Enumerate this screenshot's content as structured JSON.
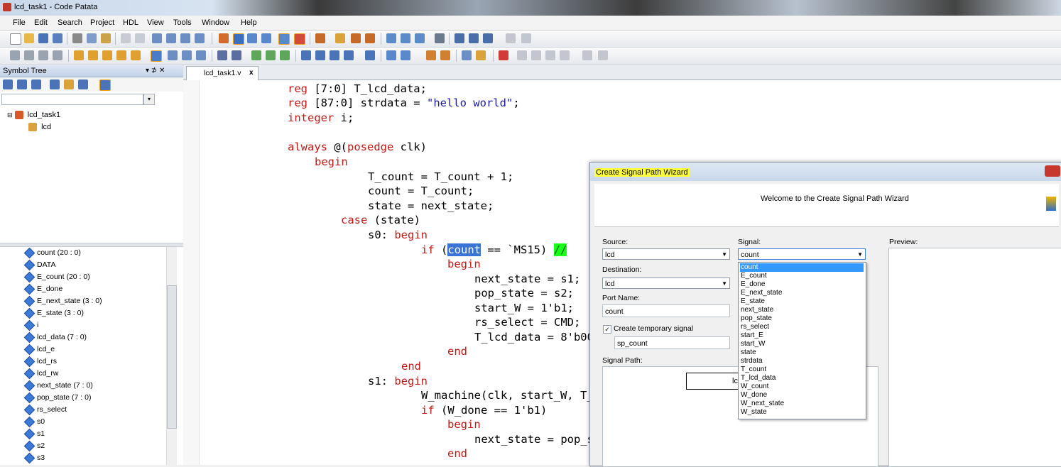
{
  "window": {
    "title": "lcd_task1 - Code Patata"
  },
  "menu": [
    "File",
    "Edit",
    "Search",
    "Project",
    "HDL",
    "View",
    "Tools",
    "Window",
    "Help"
  ],
  "symbol_tree": {
    "title": "Symbol Tree",
    "pin": "▾ ⊅ ✕",
    "root": "lcd_task1",
    "child": "lcd",
    "symbols": [
      "count (20 : 0)",
      "DATA",
      "E_count (20 : 0)",
      "E_done",
      "E_next_state (3 : 0)",
      "E_state (3 : 0)",
      "i",
      "lcd_data (7 : 0)",
      "lcd_e",
      "lcd_rs",
      "lcd_rw",
      "next_state (7 : 0)",
      "pop_state (7 : 0)",
      "rs_select",
      "s0",
      "s1",
      "s2",
      "s3"
    ]
  },
  "editor": {
    "tab": "lcd_task1.v",
    "tab_close": "x"
  },
  "dialog": {
    "title": "Create Signal Path Wizard",
    "welcome": "Welcome to the Create Signal Path Wizard",
    "source_label": "Source:",
    "source_value": "lcd",
    "signal_label": "Signal:",
    "signal_value": "count",
    "destination_label": "Destination:",
    "destination_value": "lcd",
    "port_name_label": "Port Name:",
    "port_name_value": "count",
    "temp_signal_label": "Create temporary signal",
    "temp_signal_checked": "✓",
    "temp_signal_value": "sp_count",
    "signal_path_label": "Signal Path:",
    "signal_path_node": "lc",
    "preview_label": "Preview:",
    "signal_options": [
      "count",
      "E_count",
      "E_done",
      "E_next_state",
      "E_state",
      "next_state",
      "pop_state",
      "rs_select",
      "start_E",
      "start_W",
      "state",
      "strdata",
      "T_count",
      "T_lcd_data",
      "W_count",
      "W_done",
      "W_next_state",
      "W_state"
    ],
    "selected_option": 0
  }
}
